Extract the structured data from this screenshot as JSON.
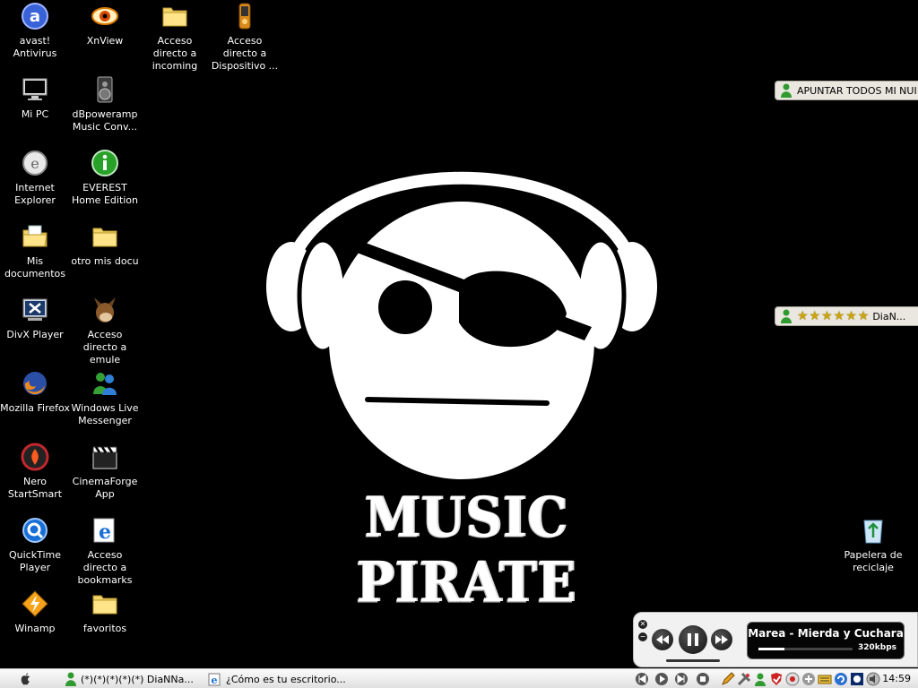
{
  "desktop_icons": [
    {
      "label": "avast! Antivirus",
      "icon": "avast-icon"
    },
    {
      "label": "XnView",
      "icon": "xnview-icon"
    },
    {
      "label": "Acceso directo a incoming",
      "icon": "folder-icon"
    },
    {
      "label": "Acceso directo a Dispositivo ...",
      "icon": "device-icon"
    },
    {
      "label": "Mi PC",
      "icon": "monitor-icon"
    },
    {
      "label": "dBpoweramp Music Conv...",
      "icon": "speaker-icon"
    },
    {
      "label": "Internet Explorer",
      "icon": "ie-icon"
    },
    {
      "label": "EVEREST Home Edition",
      "icon": "info-icon"
    },
    {
      "label": "Mis documentos",
      "icon": "documents-folder-icon"
    },
    {
      "label": "otro mis docu",
      "icon": "folder-icon"
    },
    {
      "label": "DivX Player",
      "icon": "divx-icon"
    },
    {
      "label": "Acceso directo a emule",
      "icon": "emule-icon"
    },
    {
      "label": "Mozilla Firefox",
      "icon": "firefox-icon"
    },
    {
      "label": "Windows Live Messenger",
      "icon": "messenger-icon"
    },
    {
      "label": "Nero StartSmart",
      "icon": "nero-icon"
    },
    {
      "label": "CinemaForge App",
      "icon": "clapperboard-icon"
    },
    {
      "label": "QuickTime Player",
      "icon": "quicktime-icon"
    },
    {
      "label": "Acceso directo a bookmarks",
      "icon": "ie-icon"
    },
    {
      "label": "Winamp",
      "icon": "winamp-icon"
    },
    {
      "label": "favoritos",
      "icon": "folder-icon"
    },
    {
      "label": "Papelera de reciclaje",
      "icon": "recycle-bin-icon"
    }
  ],
  "wallpaper": {
    "text": "MUSIC PIRATE"
  },
  "notifications": [
    {
      "text": "APUNTAR TODOS MI NUI..."
    },
    {
      "stars": "★★★★★★",
      "text": "DiaN..."
    }
  ],
  "player": {
    "song": "Marea - Mierda y Cuchara",
    "bitrate": "320kbps",
    "progress": 0.28
  },
  "taskbar": {
    "start_icon": "apple-icon",
    "windows": [
      {
        "label": "(*)(*)(*)(*)(*) DiaNNa...",
        "icon": "messenger-icon"
      },
      {
        "label": "¿Cómo es tu escritorio...",
        "icon": "ie-icon"
      }
    ],
    "clock": "14:59"
  },
  "colors": {
    "background": "#000000",
    "taskbar": "#eeeeee",
    "star": "#c9a310"
  }
}
